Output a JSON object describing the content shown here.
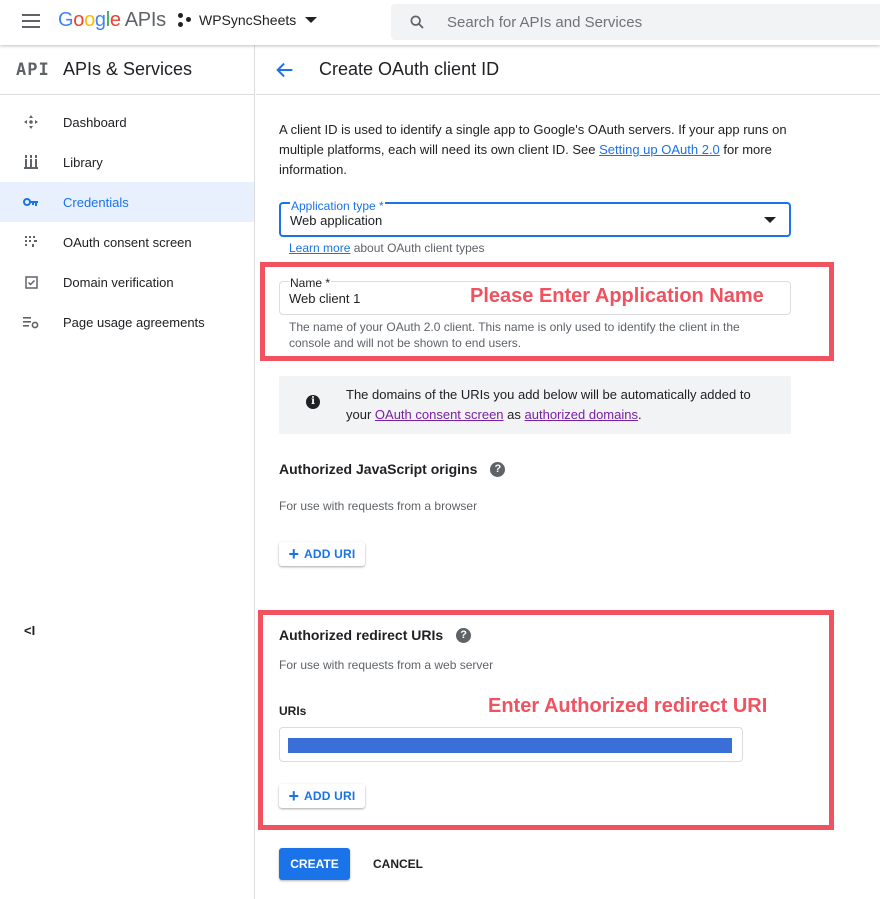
{
  "topbar": {
    "logo_google": [
      "G",
      "o",
      "o",
      "g",
      "l",
      "e"
    ],
    "logo_apis": "APIs",
    "project_name": "WPSyncSheets",
    "search_placeholder": "Search for APIs and Services"
  },
  "sidebar": {
    "api_mark": "API",
    "title": "APIs & Services",
    "items": [
      {
        "label": "Dashboard",
        "icon": "dashboard-icon"
      },
      {
        "label": "Library",
        "icon": "library-icon"
      },
      {
        "label": "Credentials",
        "icon": "key-icon",
        "active": true
      },
      {
        "label": "OAuth consent screen",
        "icon": "consent-screen-icon"
      },
      {
        "label": "Domain verification",
        "icon": "domain-check-icon"
      },
      {
        "label": "Page usage agreements",
        "icon": "settings-list-icon"
      }
    ],
    "collapse_label": "<I"
  },
  "page": {
    "title": "Create OAuth client ID",
    "intro_1": "A client ID is used to identify a single app to Google's OAuth servers. If your app runs on multiple platforms, each will need its own client ID. See ",
    "intro_link": "Setting up OAuth 2.0",
    "intro_2": " for more information.",
    "app_type_label": "Application type *",
    "app_type_value": "Web application",
    "learn_link": "Learn more",
    "learn_text": " about OAuth client types",
    "name_label": "Name *",
    "name_value": "Web client 1",
    "name_hint": "The name of your OAuth 2.0 client. This name is only used to identify the client in the console and will not be shown to end users.",
    "info_1": "The domains of the URIs you add below will be automatically added to your ",
    "info_link_1": "OAuth consent screen",
    "info_2": " as ",
    "info_link_2": "authorized domains",
    "info_3": ".",
    "js_origins_title": "Authorized JavaScript origins",
    "js_origins_sub": "For use with requests from a browser",
    "add_uri_label": "ADD URI",
    "redirect_title": "Authorized redirect URIs",
    "redirect_sub": "For use with requests from a web server",
    "uris_label": "URIs",
    "create_label": "CREATE",
    "cancel_label": "CANCEL"
  },
  "annotations": {
    "name_note": "Please Enter Application Name",
    "redirect_note": "Enter Authorized redirect URI",
    "color": "#f0525f"
  },
  "colors": {
    "accent": "#1a73e8",
    "active_bg": "#e8f0fe"
  }
}
